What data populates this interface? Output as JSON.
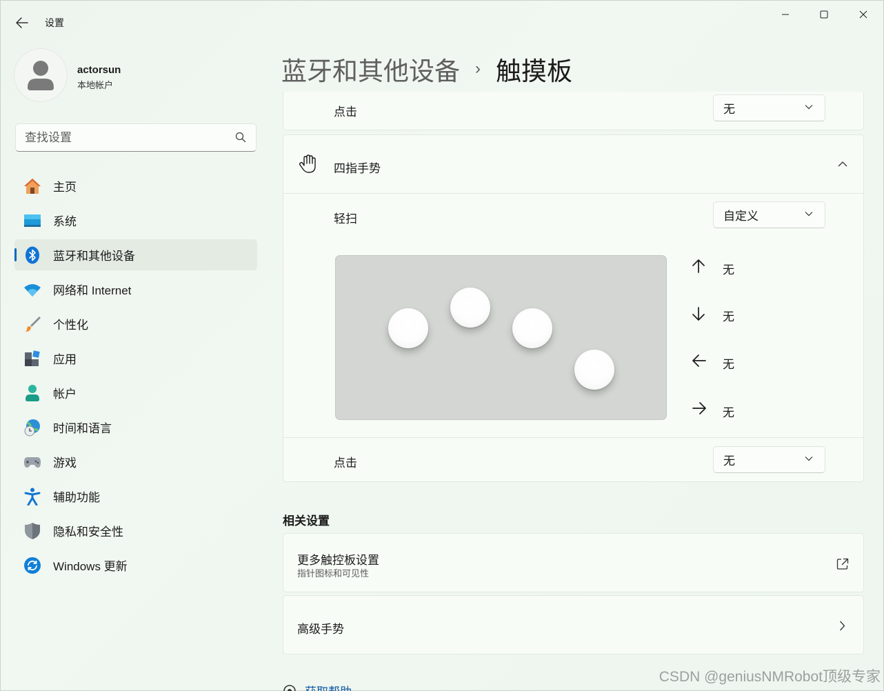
{
  "window": {
    "title": "设置"
  },
  "profile": {
    "name": "actorsun",
    "account_type": "本地帐户"
  },
  "search": {
    "placeholder": "查找设置"
  },
  "sidebar": {
    "items": [
      {
        "label": "主页",
        "icon": "home-icon"
      },
      {
        "label": "系统",
        "icon": "display-icon"
      },
      {
        "label": "蓝牙和其他设备",
        "icon": "bluetooth-icon",
        "active": true
      },
      {
        "label": "网络和 Internet",
        "icon": "wifi-icon"
      },
      {
        "label": "个性化",
        "icon": "brush-icon"
      },
      {
        "label": "应用",
        "icon": "apps-icon"
      },
      {
        "label": "帐户",
        "icon": "person-icon"
      },
      {
        "label": "时间和语言",
        "icon": "globe-clock-icon"
      },
      {
        "label": "游戏",
        "icon": "gamepad-icon"
      },
      {
        "label": "辅助功能",
        "icon": "accessibility-icon"
      },
      {
        "label": "隐私和安全性",
        "icon": "shield-icon"
      },
      {
        "label": "Windows 更新",
        "icon": "update-icon"
      }
    ]
  },
  "breadcrumb": {
    "parent": "蓝牙和其他设备",
    "separator": "›",
    "current": "触摸板"
  },
  "three_finger": {
    "tap_label": "点击",
    "tap_value": "无"
  },
  "four_finger": {
    "header": "四指手势",
    "swipe_label": "轻扫",
    "swipe_value": "自定义",
    "up": "无",
    "down": "无",
    "left": "无",
    "right": "无",
    "tap_label": "点击",
    "tap_value": "无"
  },
  "related": {
    "title": "相关设置",
    "more_title": "更多触控板设置",
    "more_sub": "指针图标和可见性",
    "advanced_title": "高级手势"
  },
  "help": {
    "label": "获取帮助"
  },
  "watermark": "CSDN @geniusNMRobot顶级专家",
  "colors": {
    "accent": "#0067c0",
    "background": "#eef5ee",
    "card": "#f7fcf7"
  }
}
